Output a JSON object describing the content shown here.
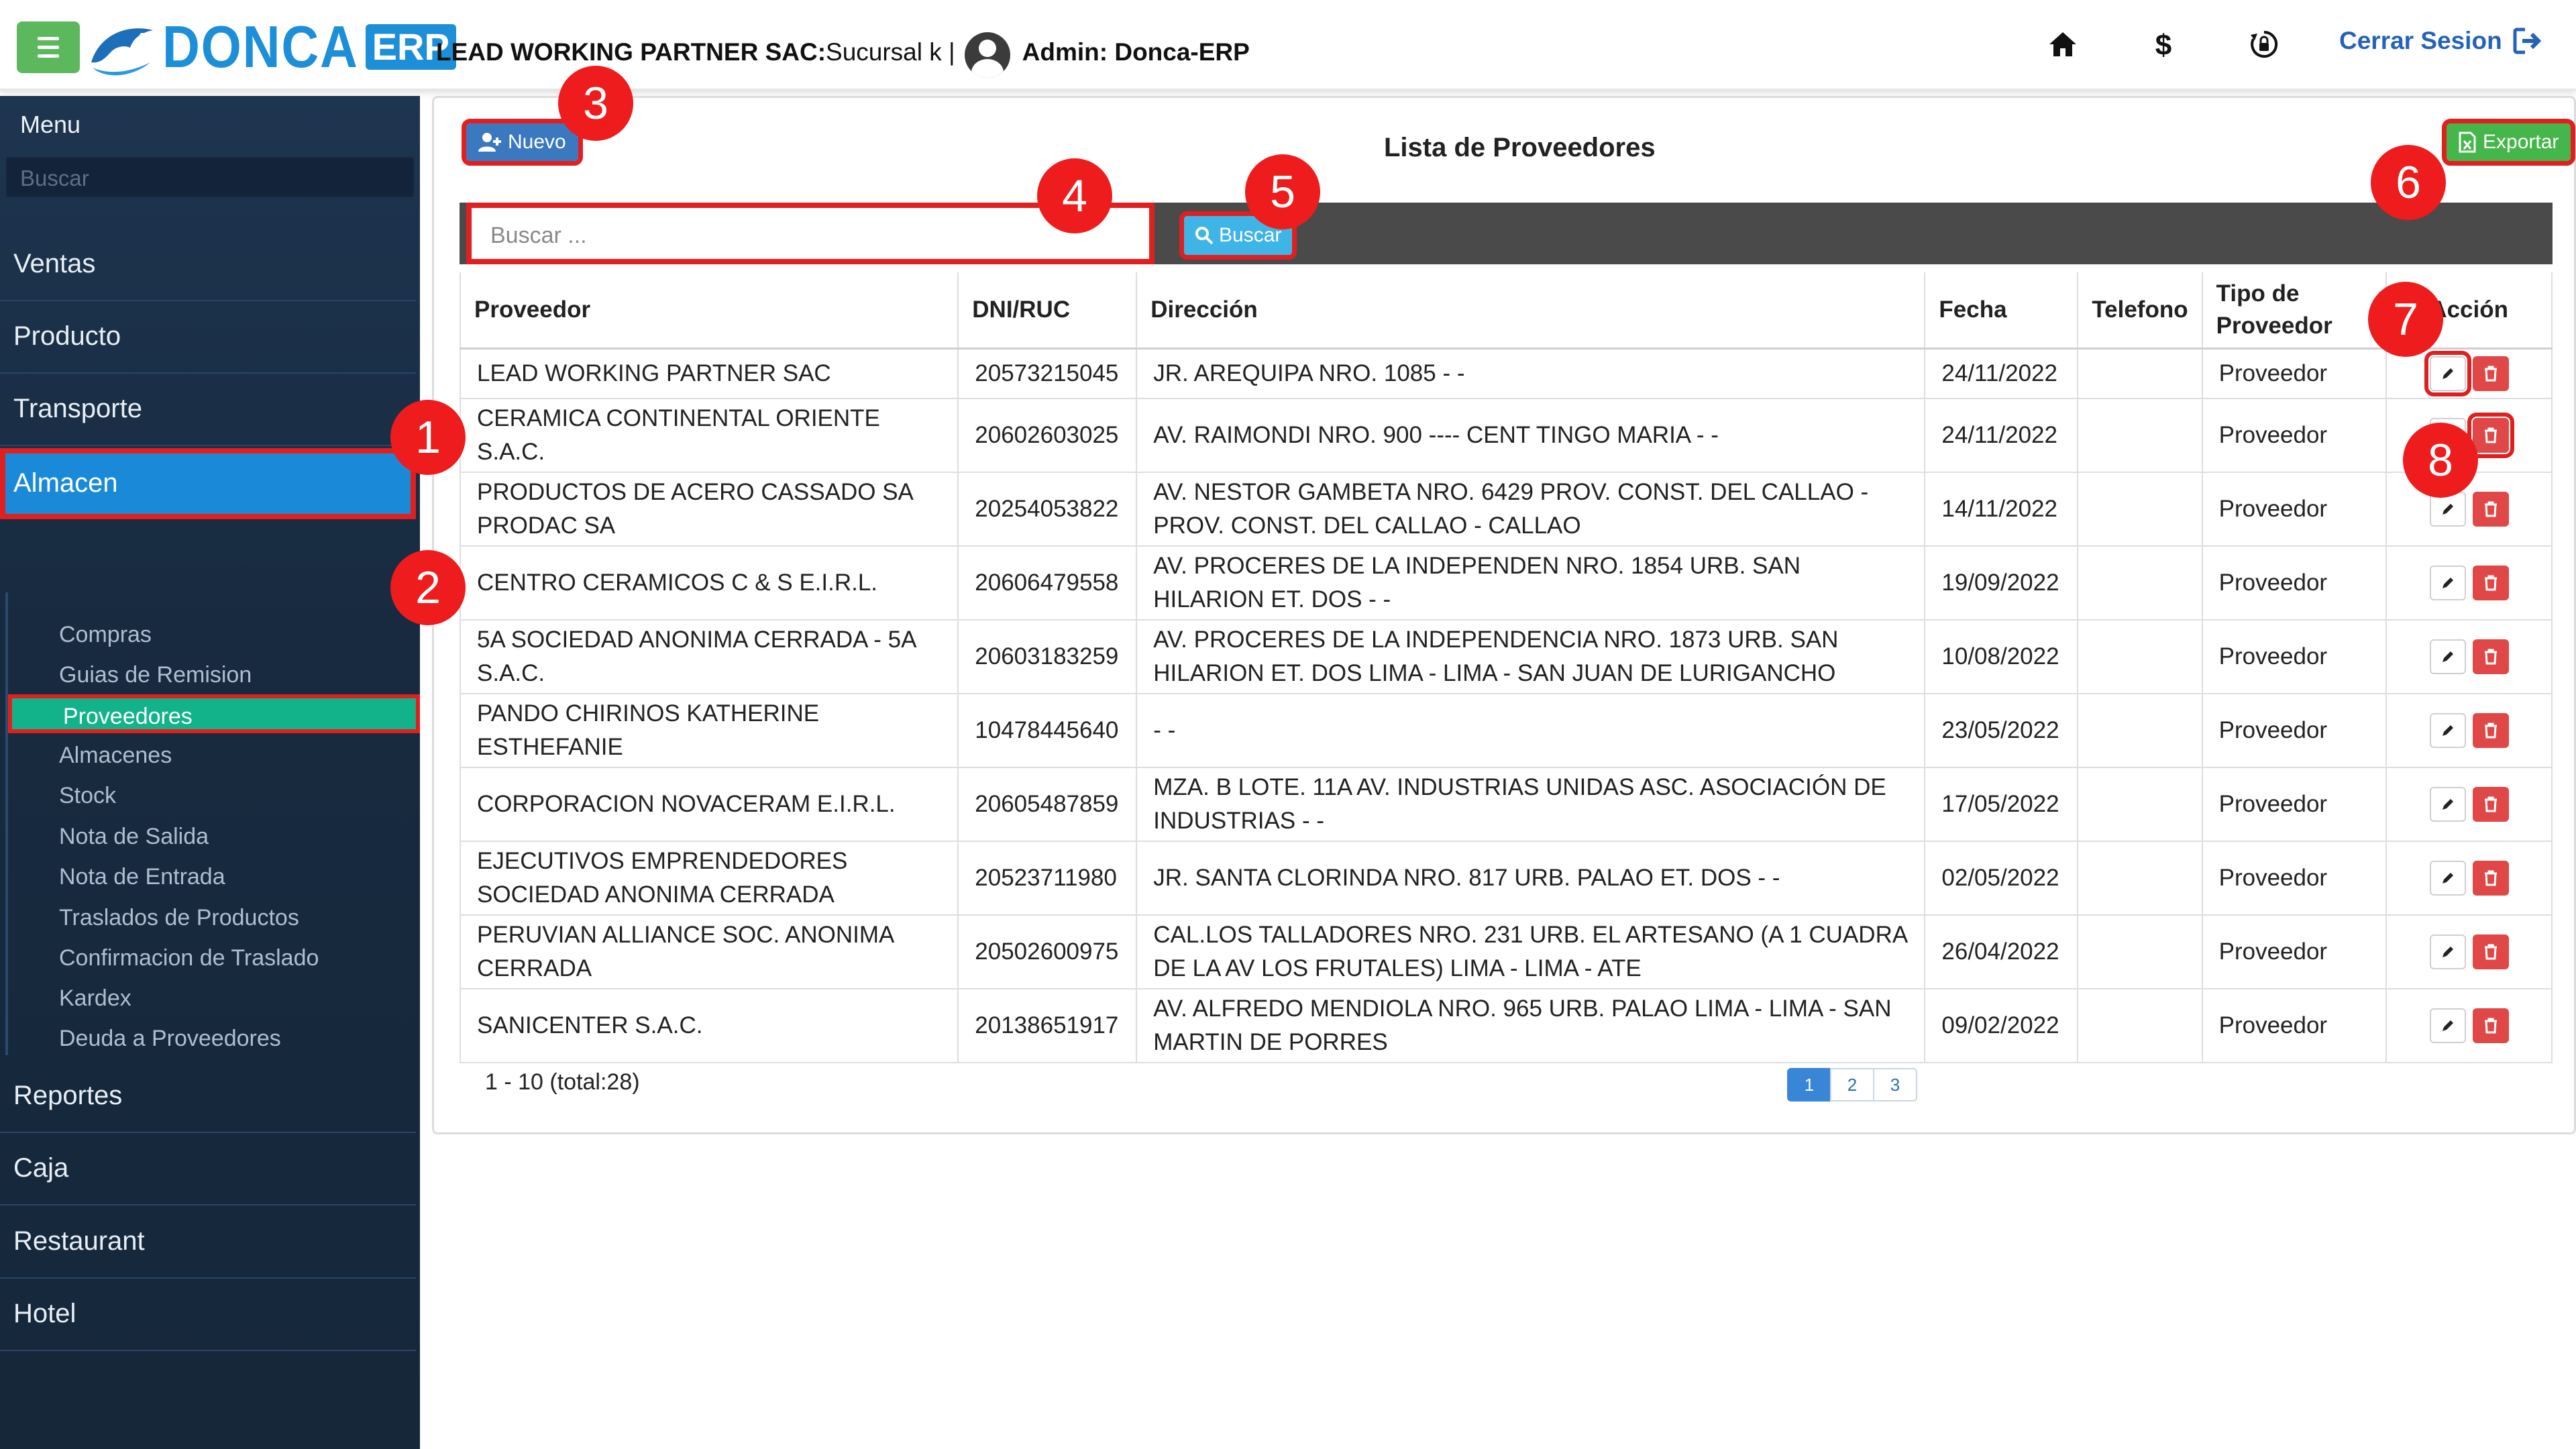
{
  "topbar": {
    "brand": "DONCA",
    "brand_suffix": "ERP",
    "company_label": "LEAD WORKING PARTNER SAC:",
    "branch": " Sucursal k |",
    "admin_label": "Admin: Donca-ERP",
    "icons": [
      "home-icon",
      "dollar-icon",
      "refresh-lock-icon"
    ],
    "logout_label": "Cerrar Sesion"
  },
  "sidebar": {
    "title": "Menu",
    "search_placeholder": "Buscar",
    "items": [
      {
        "label": "Ventas"
      },
      {
        "label": "Producto"
      },
      {
        "label": "Transporte"
      },
      {
        "label": "Almacen",
        "active": true
      },
      {
        "label": "Reportes"
      },
      {
        "label": "Caja"
      },
      {
        "label": "Restaurant"
      },
      {
        "label": "Hotel"
      }
    ],
    "subitems": [
      {
        "label": "Compras"
      },
      {
        "label": "Guias de Remision"
      },
      {
        "label": "Proveedores",
        "active": true
      },
      {
        "label": "Almacenes"
      },
      {
        "label": "Stock"
      },
      {
        "label": "Nota de Salida"
      },
      {
        "label": "Nota de Entrada"
      },
      {
        "label": "Traslados de Productos"
      },
      {
        "label": "Confirmacion de Traslado"
      },
      {
        "label": "Kardex"
      },
      {
        "label": "Deuda a Proveedores"
      }
    ]
  },
  "main": {
    "new_button": "Nuevo",
    "title": "Lista de Proveedores",
    "export_button": "Exportar",
    "search_placeholder": "Buscar ...",
    "search_button": "Buscar",
    "columns": [
      "Proveedor",
      "DNI/RUC",
      "Dirección",
      "Fecha",
      "Telefono",
      "Tipo de Proveedor",
      "Acción"
    ],
    "rows": [
      {
        "proveedor": "LEAD WORKING PARTNER SAC",
        "ruc": "20573215045",
        "direccion": "JR. AREQUIPA NRO. 1085 - -",
        "fecha": "24/11/2022",
        "telefono": "",
        "tipo": "Proveedor"
      },
      {
        "proveedor": "CERAMICA CONTINENTAL ORIENTE S.A.C.",
        "ruc": "20602603025",
        "direccion": "AV. RAIMONDI NRO. 900 ---- CENT TINGO MARIA - -",
        "fecha": "24/11/2022",
        "telefono": "",
        "tipo": "Proveedor"
      },
      {
        "proveedor": "PRODUCTOS DE ACERO CASSADO SA PRODAC SA",
        "ruc": "20254053822",
        "direccion": "AV. NESTOR GAMBETA NRO. 6429 PROV. CONST. DEL CALLAO - PROV. CONST. DEL CALLAO - CALLAO",
        "fecha": "14/11/2022",
        "telefono": "",
        "tipo": "Proveedor"
      },
      {
        "proveedor": "CENTRO CERAMICOS C & S E.I.R.L.",
        "ruc": "20606479558",
        "direccion": "AV. PROCERES DE LA INDEPENDEN NRO. 1854 URB. SAN HILARION ET. DOS - -",
        "fecha": "19/09/2022",
        "telefono": "",
        "tipo": "Proveedor"
      },
      {
        "proveedor": "5A SOCIEDAD ANONIMA CERRADA - 5A S.A.C.",
        "ruc": "20603183259",
        "direccion": "AV. PROCERES DE LA INDEPENDENCIA NRO. 1873 URB. SAN HILARION ET. DOS LIMA - LIMA - SAN JUAN DE LURIGANCHO",
        "fecha": "10/08/2022",
        "telefono": "",
        "tipo": "Proveedor"
      },
      {
        "proveedor": "PANDO CHIRINOS KATHERINE ESTHEFANIE",
        "ruc": "10478445640",
        "direccion": "- -",
        "fecha": "23/05/2022",
        "telefono": "",
        "tipo": "Proveedor"
      },
      {
        "proveedor": "CORPORACION NOVACERAM E.I.R.L.",
        "ruc": "20605487859",
        "direccion": "MZA. B LOTE. 11A AV. INDUSTRIAS UNIDAS ASC. ASOCIACIÓN DE INDUSTRIAS - -",
        "fecha": "17/05/2022",
        "telefono": "",
        "tipo": "Proveedor"
      },
      {
        "proveedor": "EJECUTIVOS EMPRENDEDORES SOCIEDAD ANONIMA CERRADA",
        "ruc": "20523711980",
        "direccion": "JR. SANTA CLORINDA NRO. 817 URB. PALAO ET. DOS - -",
        "fecha": "02/05/2022",
        "telefono": "",
        "tipo": "Proveedor"
      },
      {
        "proveedor": "PERUVIAN ALLIANCE SOC. ANONIMA CERRADA",
        "ruc": "20502600975",
        "direccion": "CAL.LOS TALLADORES NRO. 231 URB. EL ARTESANO (A 1 CUADRA DE LA AV LOS FRUTALES) LIMA - LIMA - ATE",
        "fecha": "26/04/2022",
        "telefono": "",
        "tipo": "Proveedor"
      },
      {
        "proveedor": "SANICENTER S.A.C.",
        "ruc": "20138651917",
        "direccion": "AV. ALFREDO MENDIOLA NRO. 965 URB. PALAO LIMA - LIMA - SAN MARTIN DE PORRES",
        "fecha": "09/02/2022",
        "telefono": "",
        "tipo": "Proveedor"
      }
    ],
    "record_count": "1 - 10 (total:28)",
    "pages": [
      "1",
      "2",
      "3"
    ],
    "current_page": "1"
  },
  "markers": [
    "1",
    "2",
    "3",
    "4",
    "5",
    "6",
    "7",
    "8"
  ],
  "colors": {
    "accent_blue": "#1a8ad8",
    "active_green": "#12b38b",
    "highlight_red": "#e02020",
    "export_green": "#45b649",
    "delete_red": "#e04848"
  }
}
